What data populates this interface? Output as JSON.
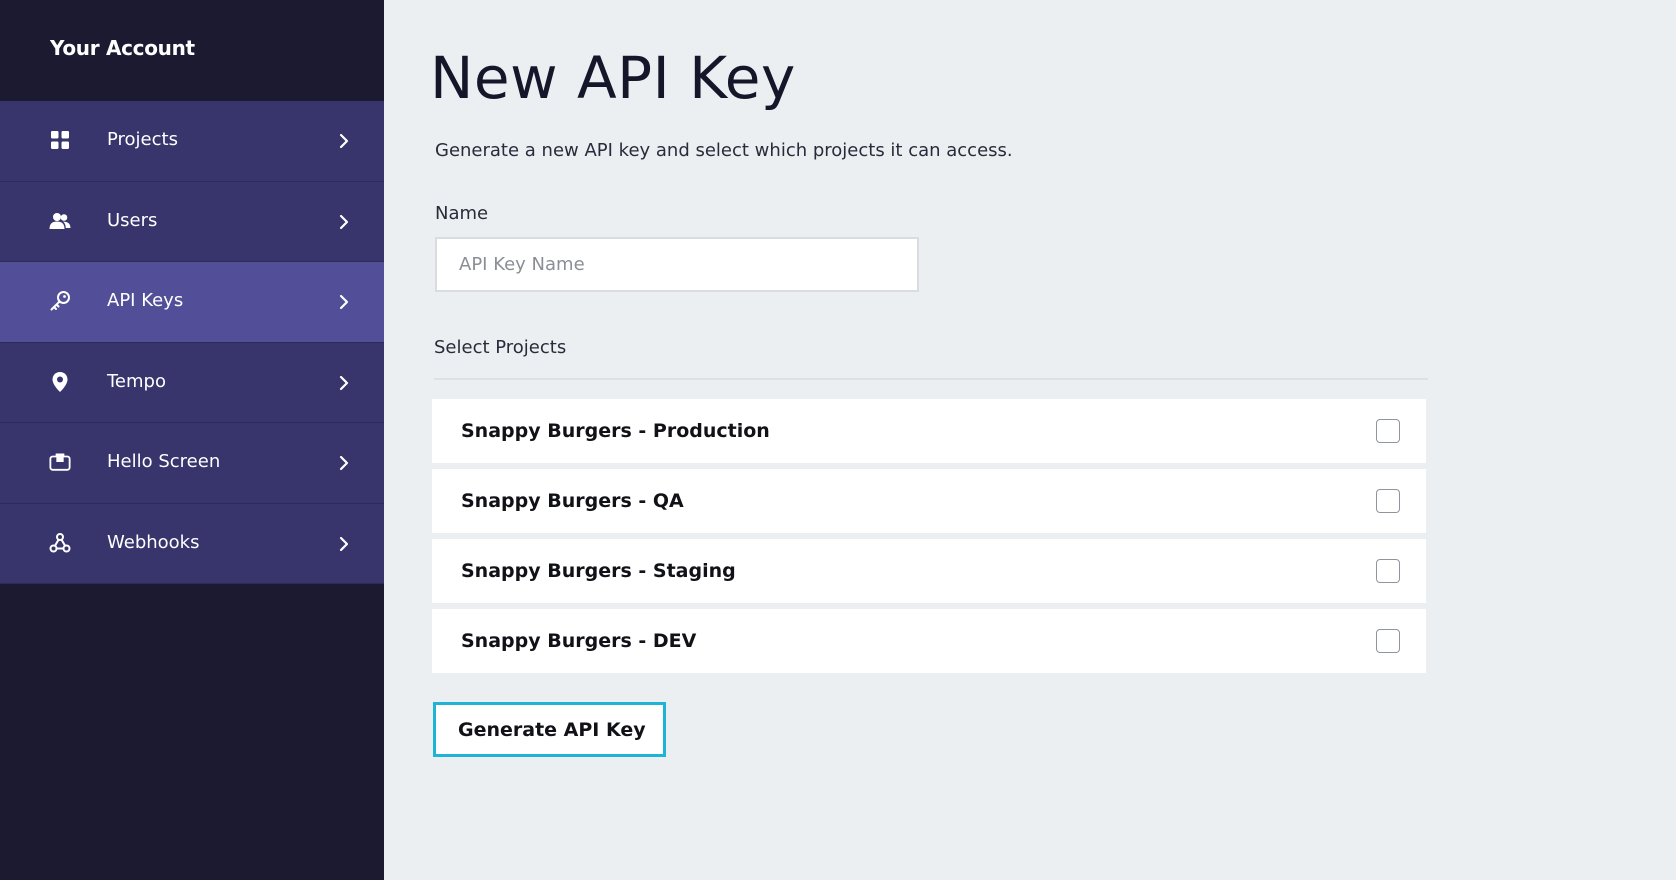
{
  "sidebar": {
    "title": "Your Account",
    "items": [
      {
        "label": "Projects",
        "icon": "grid-icon"
      },
      {
        "label": "Users",
        "icon": "users-icon"
      },
      {
        "label": "API Keys",
        "icon": "key-icon",
        "active": true
      },
      {
        "label": "Tempo",
        "icon": "location-pin-icon"
      },
      {
        "label": "Hello Screen",
        "icon": "monitor-icon"
      },
      {
        "label": "Webhooks",
        "icon": "webhook-icon"
      }
    ]
  },
  "main": {
    "title": "New API Key",
    "subtitle": "Generate a new API key and select which projects it can access.",
    "name_field": {
      "label": "Name",
      "placeholder": "API Key Name",
      "value": ""
    },
    "projects_section": {
      "label": "Select Projects",
      "projects": [
        {
          "name": "Snappy Burgers - Production",
          "checked": false
        },
        {
          "name": "Snappy Burgers - QA",
          "checked": false
        },
        {
          "name": "Snappy Burgers - Staging",
          "checked": false
        },
        {
          "name": "Snappy Burgers - DEV",
          "checked": false
        }
      ]
    },
    "generate_button_label": "Generate API Key"
  },
  "colors": {
    "sidebar_bg": "#1b1a31",
    "nav_item_bg": "#38346c",
    "nav_item_active_bg": "#524f98",
    "page_bg": "#eceff2",
    "button_border": "#1eb4d8"
  }
}
